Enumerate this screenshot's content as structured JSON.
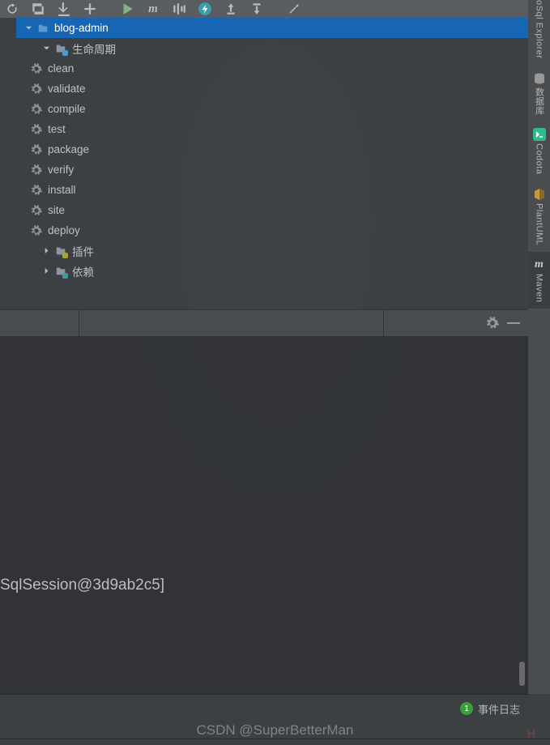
{
  "toolbar": {
    "icons": [
      "refresh",
      "sync",
      "download",
      "add",
      "play",
      "m-logo",
      "waveform",
      "bolt",
      "upload-out",
      "upload-in",
      "wrench"
    ]
  },
  "tree": {
    "root": {
      "label": "blog-admin"
    },
    "lifecycle": {
      "label": "生命周期",
      "goals": [
        "clean",
        "validate",
        "compile",
        "test",
        "package",
        "verify",
        "install",
        "site",
        "deploy"
      ]
    },
    "plugins": {
      "label": "插件"
    },
    "dependencies": {
      "label": "依赖"
    }
  },
  "rail": {
    "items": [
      {
        "label": "oSql Explorer",
        "icon": "db"
      },
      {
        "label": "数据库",
        "icon": "stack",
        "color": "#999"
      },
      {
        "label": "Codota",
        "icon": "terminal",
        "color": "#2bbd8e"
      },
      {
        "label": "PlantUML",
        "icon": "cube",
        "color": "#c99a3a"
      },
      {
        "label": "Maven",
        "icon": "m",
        "active": true
      }
    ]
  },
  "editor": {
    "snippet": "SqlSession@3d9ab2c5]"
  },
  "status": {
    "badge": "1",
    "log_label": "事件日志"
  },
  "watermark": "CSDN @SuperBetterMan",
  "watermark_red": "H"
}
